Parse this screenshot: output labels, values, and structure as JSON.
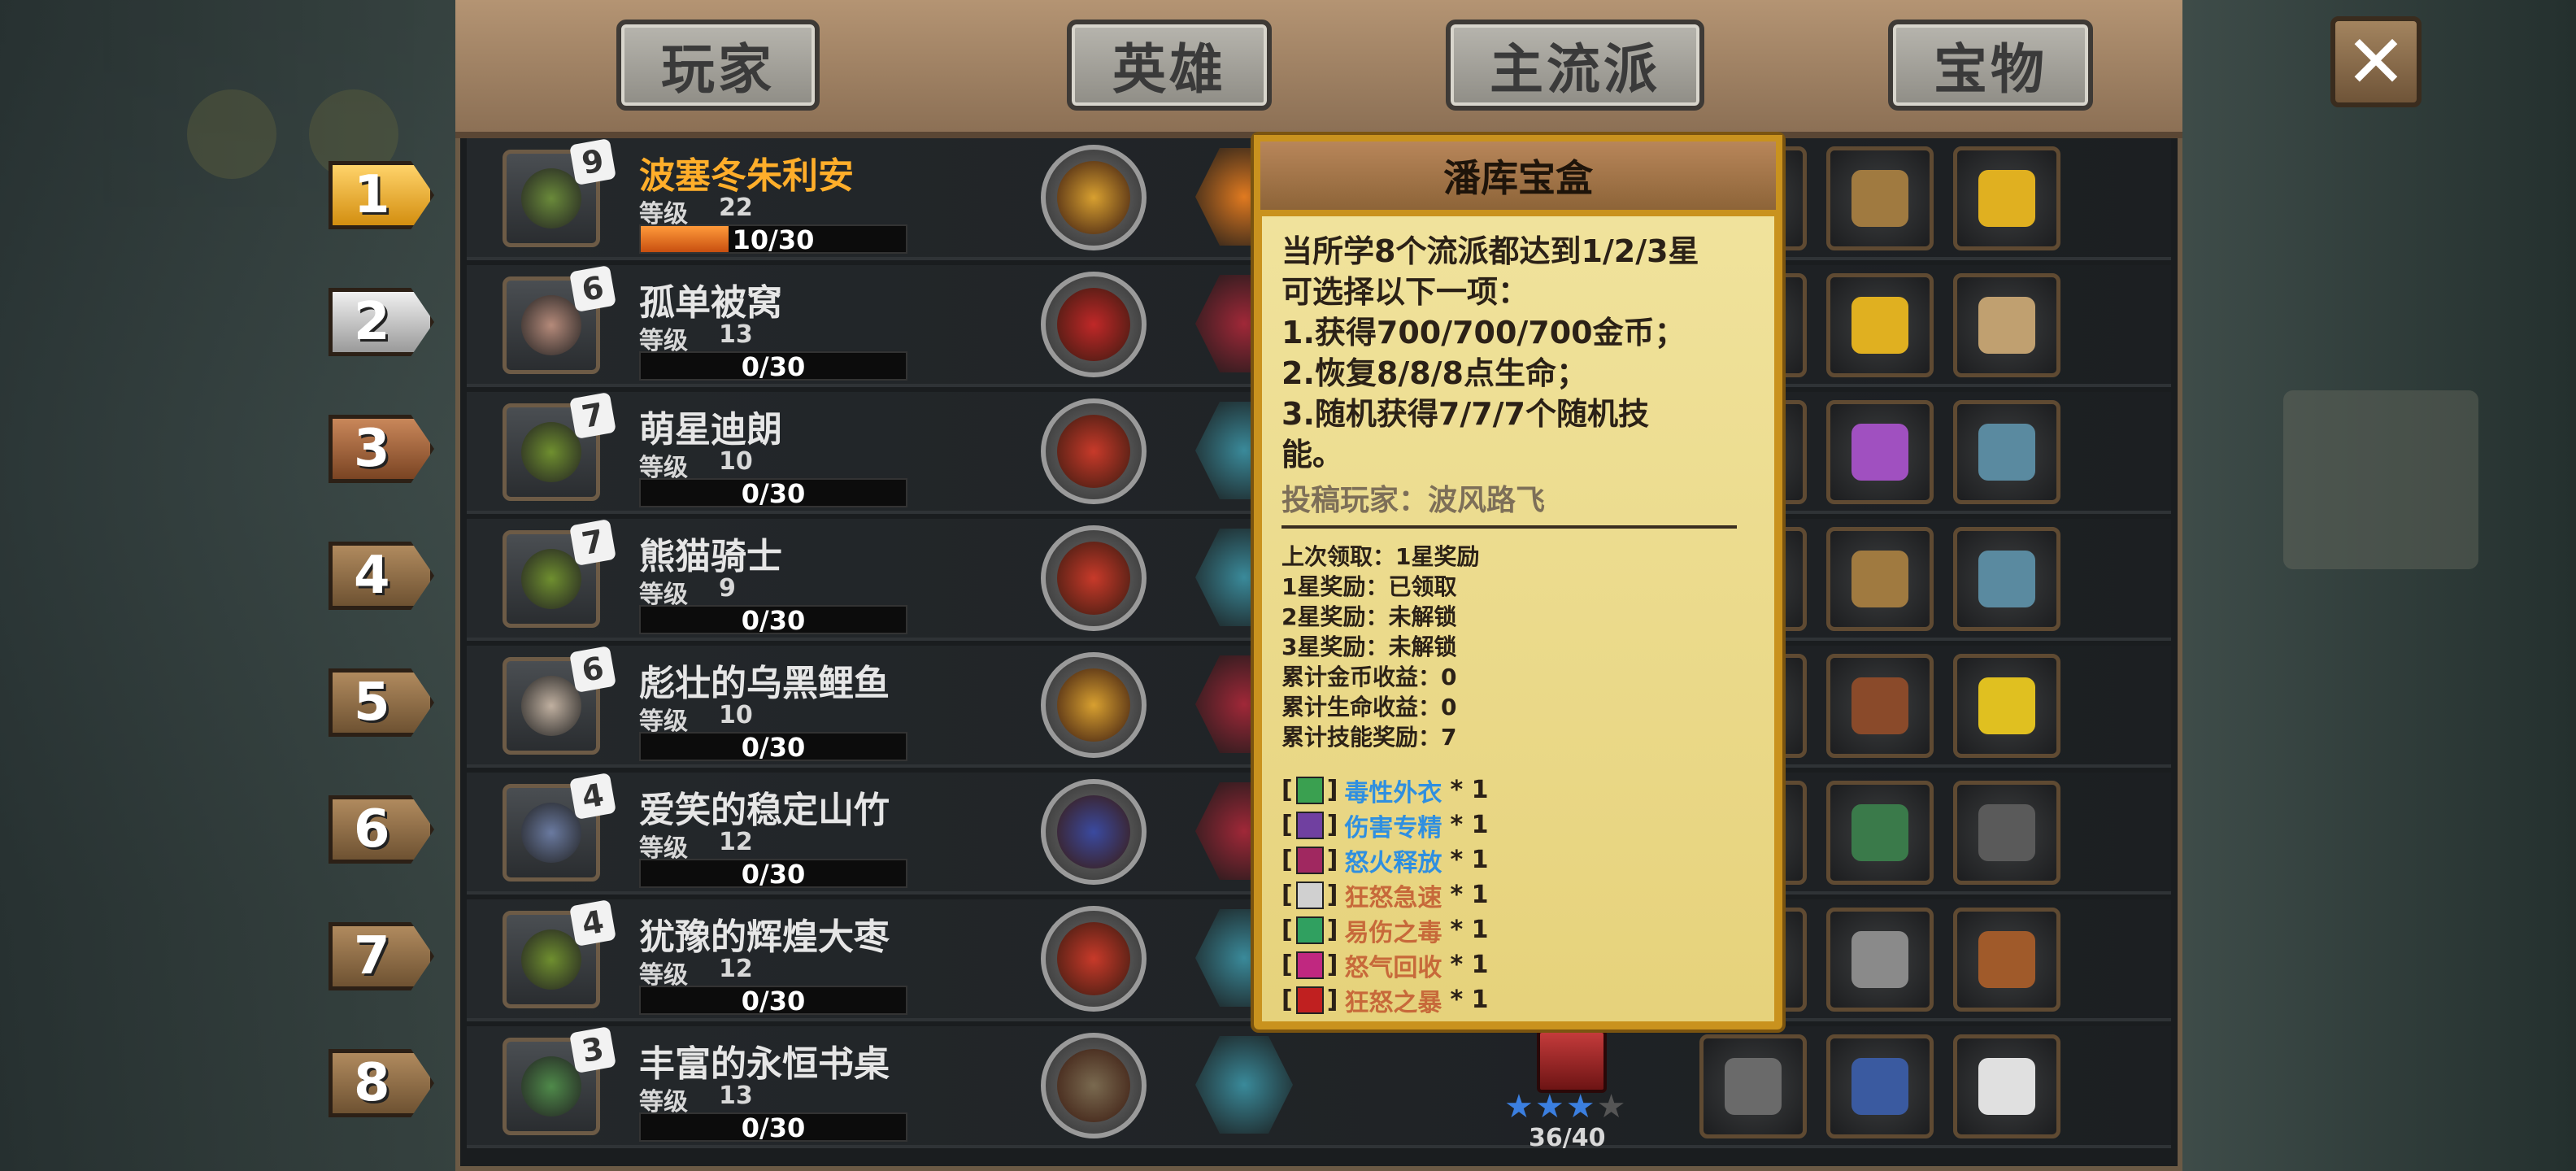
{
  "tabs": [
    "玩家",
    "英雄",
    "主流派",
    "宝物"
  ],
  "close_icon": "close-icon",
  "rows": [
    {
      "rank": "1",
      "badge": "9",
      "name": "波塞冬朱利安",
      "level_label": "等级",
      "level": "22",
      "xp": "10/30",
      "xp_fraction": 0.33
    },
    {
      "rank": "2",
      "badge": "6",
      "name": "孤单被窝",
      "level_label": "等级",
      "level": "13",
      "xp": "0/30",
      "xp_fraction": 0
    },
    {
      "rank": "3",
      "badge": "7",
      "name": "萌星迪朗",
      "level_label": "等级",
      "level": "10",
      "xp": "0/30",
      "xp_fraction": 0
    },
    {
      "rank": "4",
      "badge": "7",
      "name": "熊猫骑士",
      "level_label": "等级",
      "level": "9",
      "xp": "0/30",
      "xp_fraction": 0
    },
    {
      "rank": "5",
      "badge": "6",
      "name": "彪壮的乌黑鲤鱼",
      "level_label": "等级",
      "level": "10",
      "xp": "0/30",
      "xp_fraction": 0
    },
    {
      "rank": "6",
      "badge": "4",
      "name": "爱笑的稳定山竹",
      "level_label": "等级",
      "level": "12",
      "xp": "0/30",
      "xp_fraction": 0
    },
    {
      "rank": "7",
      "badge": "4",
      "name": "犹豫的辉煌大枣",
      "level_label": "等级",
      "level": "12",
      "xp": "0/30",
      "xp_fraction": 0
    },
    {
      "rank": "8",
      "badge": "3",
      "name": "丰富的永恒书桌",
      "level_label": "等级",
      "level": "13",
      "xp": "0/30",
      "xp_fraction": 0
    }
  ],
  "popup": {
    "title": "潘库宝盒",
    "desc_lines": [
      "当所学8个流派都达到1/2/3星",
      "可选择以下一项：",
      "1.获得700/700/700金币；",
      "2.恢复8/8/8点生命；",
      "3.随机获得7/7/7个随机技",
      "能。"
    ],
    "credit": "投稿玩家：波风路飞",
    "stats": [
      "上次领取：1星奖励",
      "1星奖励：已领取",
      "2星奖励：未解锁",
      "3星奖励：未解锁",
      "累计金币收益：0",
      "累计生命收益：0",
      "累计技能奖励：7"
    ],
    "skills": [
      {
        "name": "毒性外衣",
        "count": "* 1",
        "color": "#2f8fe0"
      },
      {
        "name": "伤害专精",
        "count": "* 1",
        "color": "#2f8fe0"
      },
      {
        "name": "怒火释放",
        "count": "* 1",
        "color": "#2f8fe0"
      },
      {
        "name": "狂怒急速",
        "count": "* 1",
        "color": "#c7693a"
      },
      {
        "name": "易伤之毒",
        "count": "* 1",
        "color": "#c7693a"
      },
      {
        "name": "怒气回收",
        "count": "* 1",
        "color": "#c7693a"
      },
      {
        "name": "狂怒之暴",
        "count": "* 1",
        "color": "#c7693a"
      }
    ]
  },
  "school_progress": {
    "stars_filled": 3,
    "stars_total": 4,
    "text": "36/40"
  }
}
